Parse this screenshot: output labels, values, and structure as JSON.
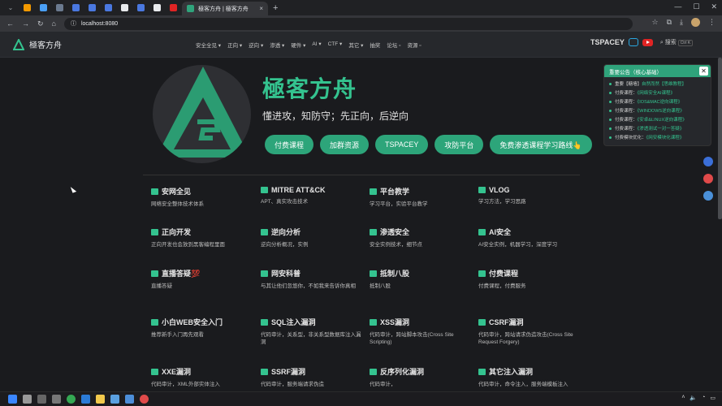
{
  "browser": {
    "tab_title": "極客方舟 | 極客方舟",
    "url": "localhost:8080",
    "new_tab": "+",
    "close_tab": "×"
  },
  "site": {
    "logo_text": "極客方舟",
    "nav": [
      "安全全见 ▾",
      "正向 ▾",
      "逆向 ▾",
      "渗透 ▾",
      "硬件 ▾",
      "AI ▾",
      "CTF ▾",
      "其它 ▾",
      "抽奖",
      "论坛 ▫",
      "资源 ▫"
    ],
    "brand": "TSPACEY",
    "search_label": "搜索",
    "search_kbd": "Ctrl K"
  },
  "hero": {
    "title": "極客方舟",
    "subtitle": "懂进攻，知防守；先正向，后逆向",
    "buttons": [
      "付费课程",
      "加群资源",
      "TSPACEY",
      "攻防平台",
      "免费渗透课程学习路线👆"
    ]
  },
  "cards": [
    {
      "title": "安网全见",
      "desc": "网络安全整体技术体系"
    },
    {
      "title": "MITRE ATT&CK",
      "desc": "APT、真实攻击技术"
    },
    {
      "title": "平台教学",
      "desc": "学习平台，实验平台教学"
    },
    {
      "title": "VLOG",
      "desc": "学习方法，学习思路"
    },
    {
      "title": "正向开发",
      "desc": "正向开发也会放到黑客编程里面"
    },
    {
      "title": "逆向分析",
      "desc": "逆向分析概况，实例"
    },
    {
      "title": "渗透安全",
      "desc": "安全实例技术，细节点"
    },
    {
      "title": "AI安全",
      "desc": "AI安全实例，机器学习，深度学习"
    },
    {
      "title": "直播答疑💯",
      "desc": "直播答疑"
    },
    {
      "title": "网安科普",
      "desc": "与其让他们忽悠你，不如我来告诉你真相"
    },
    {
      "title": "抵制八股",
      "desc": "抵制八股"
    },
    {
      "title": "付费课程",
      "desc": "付费课程，付费服务"
    },
    {
      "title": "小白WEB安全入门",
      "desc": "推荐新手入门再先观看"
    },
    {
      "title": "SQL注入漏洞",
      "desc": "代码审计，关系型，非关系型数据库注入漏洞"
    },
    {
      "title": "XSS漏洞",
      "desc": "代码审计，跨站脚本攻击(Cross Site Scripting)"
    },
    {
      "title": "CSRF漏洞",
      "desc": "代码审计，跨站请求伪造攻击(Cross Site Request Forgery)"
    },
    {
      "title": "XXE漏洞",
      "desc": "代码审计，XML外部实体注入"
    },
    {
      "title": "SSRF漏洞",
      "desc": "代码审计，服务端请求伪造"
    },
    {
      "title": "反序列化漏洞",
      "desc": "代码审计，"
    },
    {
      "title": "其它注入漏洞",
      "desc": "代码审计，命令注入，服务端模板注入"
    }
  ],
  "notice": {
    "title": "重要公告（核心基础）",
    "items": [
      {
        "prefix": "重要【糖墙】",
        "link": "自然而然【思维教程】"
      },
      {
        "prefix": "付费课程：",
        "link": "《网络安全AI课程》"
      },
      {
        "prefix": "付费课程：",
        "link": "《IOS&MAC逆向课程》"
      },
      {
        "prefix": "付费课程：",
        "link": "《WINDOWS逆向课程》"
      },
      {
        "prefix": "付费课程：",
        "link": "《安卓&LINUX逆向课程》"
      },
      {
        "prefix": "付费课程：",
        "link": "《渗透测试一对一答疑》"
      },
      {
        "prefix": "付费模块优化：",
        "link": "《网安模块化课程》"
      }
    ]
  },
  "colors": {
    "accent": "#34c38f",
    "button": "#2da57a",
    "bg": "#1a1b1e"
  }
}
